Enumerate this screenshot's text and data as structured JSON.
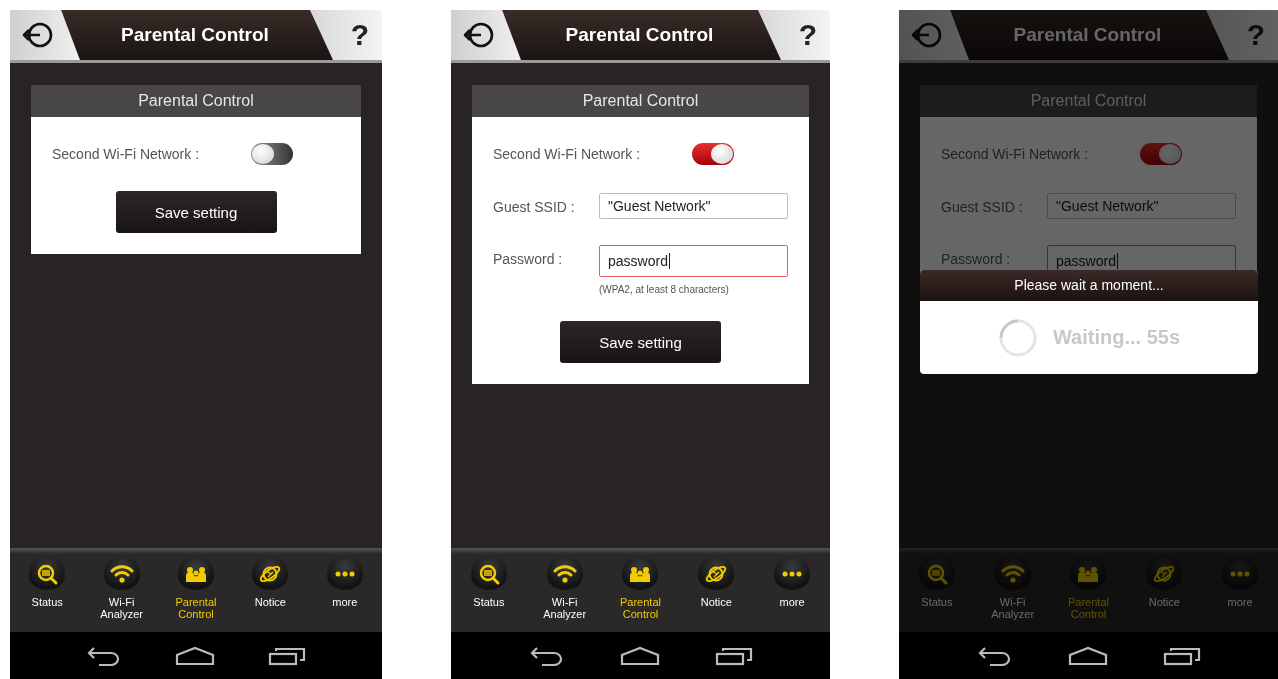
{
  "screens": [
    {
      "header": {
        "title": "Parental Control",
        "help": "?"
      },
      "panel": {
        "title": "Parental Control",
        "toggle": {
          "label": "Second Wi-Fi Network :",
          "on": false
        },
        "save_button": "Save setting"
      },
      "nav": [
        {
          "kind": "status",
          "label": "Status",
          "selected": false
        },
        {
          "kind": "wifi",
          "label": "Wi-Fi Analyzer",
          "selected": false
        },
        {
          "kind": "family",
          "label": "Parental Control",
          "selected": true
        },
        {
          "kind": "planet",
          "label": "Notice",
          "selected": false
        },
        {
          "kind": "more",
          "label": "more",
          "selected": false
        }
      ]
    },
    {
      "header": {
        "title": "Parental Control",
        "help": "?"
      },
      "panel": {
        "title": "Parental Control",
        "toggle": {
          "label": "Second Wi-Fi Network :",
          "on": true
        },
        "fields": [
          {
            "label": "Guest SSID :",
            "value": "\"Guest Network\"",
            "focused": false
          },
          {
            "label": "Password :",
            "value": "password",
            "focused": true,
            "hint": "(WPA2, at least 8 characters)"
          }
        ],
        "save_button": "Save setting"
      },
      "nav": [
        {
          "kind": "status",
          "label": "Status",
          "selected": false
        },
        {
          "kind": "wifi",
          "label": "Wi-Fi Analyzer",
          "selected": false
        },
        {
          "kind": "family",
          "label": "Parental Control",
          "selected": true
        },
        {
          "kind": "planet",
          "label": "Notice",
          "selected": false
        },
        {
          "kind": "more",
          "label": "more",
          "selected": false
        }
      ]
    },
    {
      "header": {
        "title": "Parental Control",
        "help": "?"
      },
      "panel": {
        "title": "Parental Control",
        "toggle": {
          "label": "Second Wi-Fi Network :",
          "on": true
        },
        "fields": [
          {
            "label": "Guest SSID :",
            "value": "\"Guest Network\"",
            "focused": false
          },
          {
            "label": "Password :",
            "value": "password",
            "focused": true
          }
        ]
      },
      "nav": [
        {
          "kind": "status",
          "label": "Status",
          "selected": false
        },
        {
          "kind": "wifi",
          "label": "Wi-Fi Analyzer",
          "selected": false
        },
        {
          "kind": "family",
          "label": "Parental Control",
          "selected": true
        },
        {
          "kind": "planet",
          "label": "Notice",
          "selected": false
        },
        {
          "kind": "more",
          "label": "more",
          "selected": false
        }
      ],
      "dialog": {
        "title": "Please wait a moment...",
        "message": "Waiting... 55s"
      }
    }
  ]
}
